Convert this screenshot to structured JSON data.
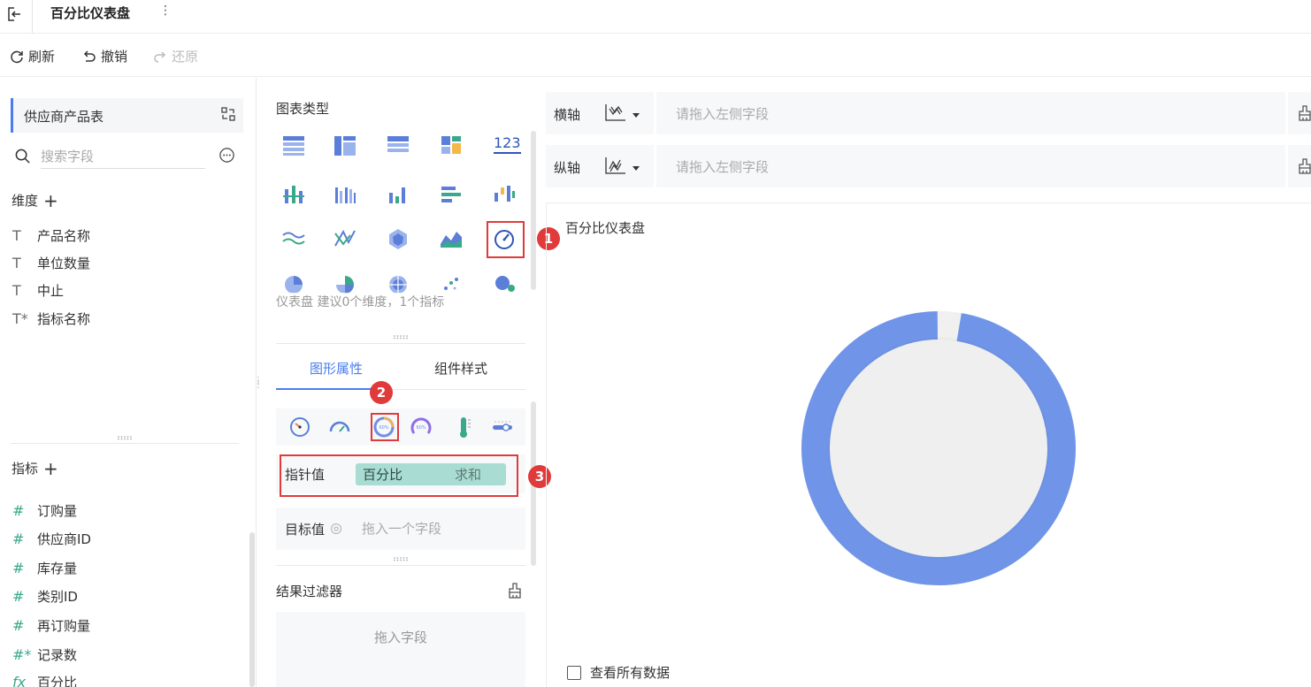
{
  "title": "百分比仪表盘",
  "toolbar": {
    "refresh": "刷新",
    "undo": "撤销",
    "redo": "还原"
  },
  "left": {
    "dataset": "供应商产品表",
    "search_placeholder": "搜索字段",
    "dimensions_title": "维度",
    "dimensions": [
      "产品名称",
      "单位数量",
      "中止",
      "指标名称"
    ],
    "measures_title": "指标",
    "measures": [
      "订购量",
      "供应商ID",
      "库存量",
      "类别ID",
      "再订购量",
      "记录数",
      "百分比"
    ],
    "icons": {
      "text": "T",
      "text_star": "T*",
      "number": "#",
      "number_star": "#*",
      "formula": "fx"
    }
  },
  "middle": {
    "chart_type_label": "图表类型",
    "number_chart_label": "123",
    "chart_hint": "仪表盘 建议0个维度，1个指标",
    "tabs": {
      "shape": "图形属性",
      "style": "组件样式"
    },
    "pointer_label": "指针值",
    "pointer_field": "百分比",
    "pointer_agg": "求和",
    "target_label": "目标值",
    "target_placeholder": "拖入一个字段",
    "filter_label": "结果过滤器",
    "filter_placeholder": "拖入字段",
    "gauge_icon_text": "60%"
  },
  "badges": [
    "1",
    "2",
    "3"
  ],
  "right": {
    "x_axis_label": "横轴",
    "y_axis_label": "纵轴",
    "axis_placeholder": "请拖入左侧字段",
    "chart_title": "百分比仪表盘",
    "view_all": "查看所有数据"
  },
  "gauge": {
    "percent": 0.975,
    "ring_color": "#7095e8",
    "track_color": "#f0f0f0",
    "center_color": "#efefef"
  },
  "colors": {
    "accent": "#4a7cf0",
    "highlight": "#e03a3a",
    "chip": "#a9dcd2",
    "measure_icon": "#3aa88a"
  }
}
